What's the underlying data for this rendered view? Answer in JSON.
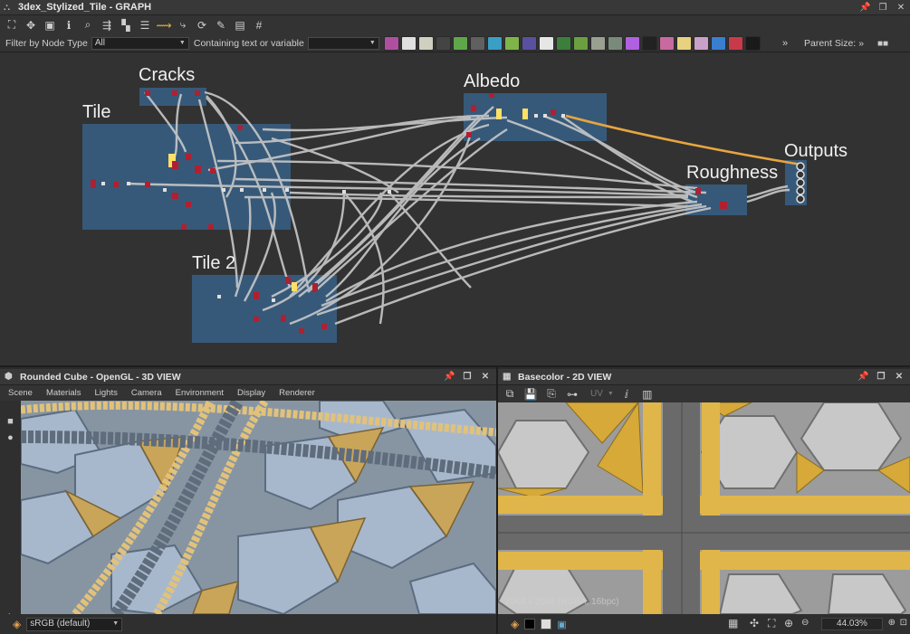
{
  "window": {
    "title": "3dex_Stylized_Tile - GRAPH"
  },
  "filter": {
    "label": "Filter by Node Type",
    "type_value": "All",
    "contains_label": "Containing text or variable",
    "contains_value": "",
    "parent_size_label": "Parent Size:"
  },
  "graph": {
    "frames": [
      {
        "name": "cracks",
        "label": "Cracks"
      },
      {
        "name": "tile",
        "label": "Tile"
      },
      {
        "name": "tile-2",
        "label": "Tile 2"
      },
      {
        "name": "albedo",
        "label": "Albedo"
      },
      {
        "name": "roughness",
        "label": "Roughness"
      },
      {
        "name": "outputs",
        "label": "Outputs"
      }
    ],
    "colors": {
      "frame": "#375979",
      "link": "#c8c8c8",
      "link_active": "#e8a540",
      "node": "#b02030"
    }
  },
  "view3d": {
    "title": "Rounded Cube - OpenGL - 3D VIEW",
    "menu": [
      "Scene",
      "Materials",
      "Lights",
      "Camera",
      "Environment",
      "Display",
      "Renderer"
    ],
    "colorspace": "sRGB (default)"
  },
  "view2d": {
    "title": "Basecolor - 2D VIEW",
    "uv_label": "UV",
    "resolution": "2048 x 2048 (RGBA, 16bpc)",
    "zoom": "44.03%"
  }
}
